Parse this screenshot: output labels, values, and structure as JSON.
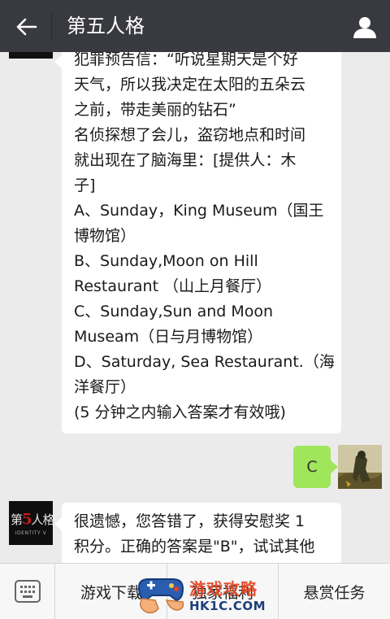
{
  "header": {
    "title": "第五人格",
    "colors": {
      "bg": "#393a3f"
    }
  },
  "chat": {
    "messages": [
      {
        "side": "left",
        "lines": [
          "犯罪预告信：“听说星期天是个好",
          "天气，所以我决定在太阳的五朵云",
          "之前，带走美丽的钻石”",
          "名侦探想了会儿，盗窃地点和时间",
          "就出现在了脑海里：[提供人：木",
          "子]",
          "A、Sunday，King Museum（国王",
          "博物馆）",
          "B、Sunday,Moon on Hill",
          "Restaurant （山上月餐厅）",
          "C、Sunday,Sun and Moon",
          "Museam（日与月博物馆）",
          "D、Saturday, Sea Restaurant.（海",
          "洋餐厅）",
          "(5 分钟之内输入答案才有效哦)"
        ]
      },
      {
        "side": "right",
        "text": "C"
      },
      {
        "side": "left",
        "lines": [
          "很遗憾，您答错了，获得安慰奖 1",
          "积分。正确的答案是\"B\"，试试其他"
        ]
      }
    ],
    "logo": {
      "main_pre": "第",
      "main_five": "5",
      "main_post": "人格",
      "sub": "IDENTITY V"
    },
    "colors": {
      "bg": "#ebebeb",
      "bubble_left": "#ffffff",
      "bubble_right": "#9fe65a"
    }
  },
  "menu": {
    "items": [
      "游戏下载",
      "独家福利",
      "悬赏任务"
    ]
  },
  "watermark": {
    "text": "游戏攻略",
    "url": "HK1C.COM"
  }
}
